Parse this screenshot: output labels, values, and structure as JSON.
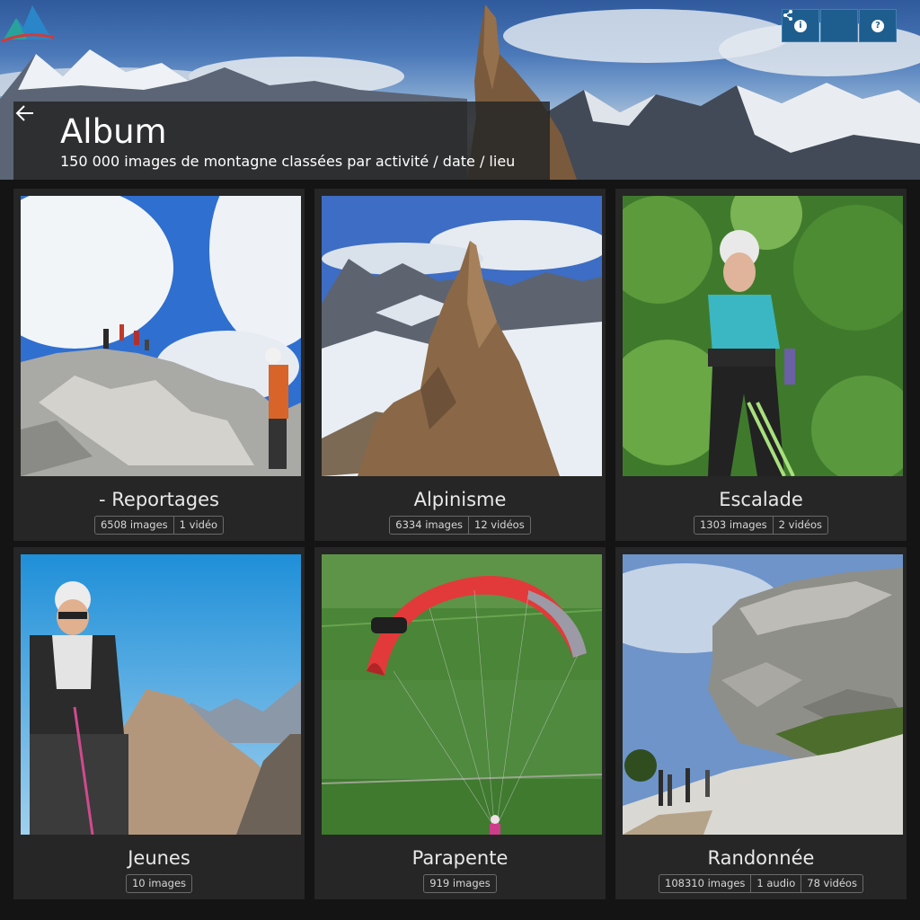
{
  "header": {
    "title": "Album",
    "subtitle": "150 000 images de montagne classées par activité / date / lieu"
  },
  "toolbar": [
    {
      "name": "info-button",
      "icon": "info-icon",
      "glyph": "i"
    },
    {
      "name": "share-button",
      "icon": "share-icon",
      "glyph": "<"
    },
    {
      "name": "help-button",
      "icon": "help-icon",
      "glyph": "?"
    }
  ],
  "colors": {
    "accent": "#1d5e8f",
    "card_bg": "#262626",
    "page_bg": "#141414"
  },
  "albums": [
    {
      "title": "- Reportages",
      "stats": [
        "6508 images",
        "1 vidéo"
      ]
    },
    {
      "title": "Alpinisme",
      "stats": [
        "6334 images",
        "12 vidéos"
      ]
    },
    {
      "title": "Escalade",
      "stats": [
        "1303 images",
        "2 vidéos"
      ]
    },
    {
      "title": "Jeunes",
      "stats": [
        "10 images"
      ]
    },
    {
      "title": "Parapente",
      "stats": [
        "919 images"
      ]
    },
    {
      "title": "Randonnée",
      "stats": [
        "108310 images",
        "1 audio",
        "78 vidéos"
      ]
    }
  ]
}
